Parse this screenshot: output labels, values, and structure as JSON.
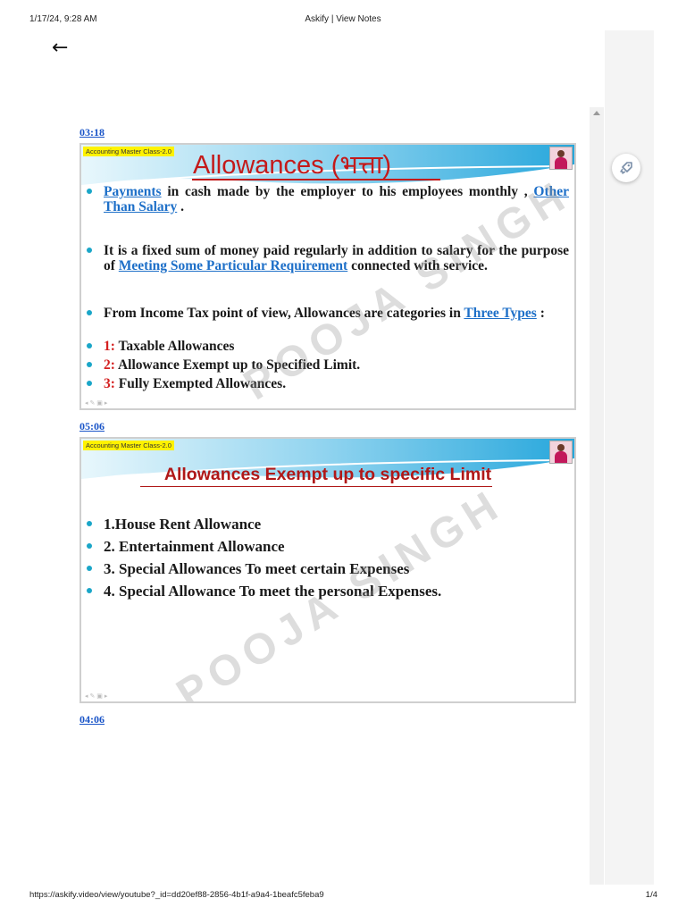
{
  "print": {
    "date": "1/17/24, 9:28 AM",
    "title": "Askify | View Notes",
    "url": "https://askify.video/view/youtube?_id=dd20ef88-2856-4b1f-a9a4-1beafc5feba9",
    "page": "1/4"
  },
  "nav": {
    "back_icon": "arrow-left-icon",
    "back_glyph": "←"
  },
  "side_button": {
    "icon": "rocket-icon"
  },
  "colors": {
    "timestamp_link": "#1a55c8",
    "slide_title_red": "#c41a1a",
    "link_blue": "#1d6fc8",
    "bullet_cyan": "#1aa6c8",
    "tagline_yellow": "#fff200"
  },
  "notes": [
    {
      "timestamp": "03:18",
      "slide": {
        "tagline": "Accounting Master Class-2.0",
        "title_en": "Allowances (",
        "title_hi": "भत्ता",
        "title_close": ")",
        "watermark": "POOJA SINGH",
        "bullets": [
          {
            "parts": [
              {
                "t": "Payments",
                "s": "link"
              },
              {
                "t": " in cash made by the employer to his employees monthly ",
                "s": ""
              },
              {
                "t": ", ",
                "s": ""
              },
              {
                "t": "Other Than Salary",
                "s": "link"
              },
              {
                "t": " .",
                "s": ""
              }
            ]
          },
          {
            "parts": [
              {
                "t": "It is a fixed sum of money paid regularly in addition to salary for the purpose of ",
                "s": ""
              },
              {
                "t": "Meeting Some Particular Requirement",
                "s": "link"
              },
              {
                "t": " connected with service.",
                "s": ""
              }
            ]
          },
          {
            "parts": [
              {
                "t": "From Income Tax point of view, Allowances are categories in ",
                "s": ""
              },
              {
                "t": "Three Types",
                "s": "link"
              },
              {
                "t": " :",
                "s": ""
              }
            ]
          },
          {
            "parts": [
              {
                "t": "1:",
                "s": "num"
              },
              {
                "t": " Taxable Allowances",
                "s": ""
              }
            ]
          },
          {
            "parts": [
              {
                "t": "2:",
                "s": "num"
              },
              {
                "t": " Allowance Exempt up to Specified Limit.",
                "s": ""
              }
            ]
          },
          {
            "parts": [
              {
                "t": "3:",
                "s": "num"
              },
              {
                "t": " Fully Exempted Allowances.",
                "s": ""
              }
            ]
          }
        ]
      }
    },
    {
      "timestamp": "05:06",
      "slide": {
        "tagline": "Accounting Master Class-2.0",
        "title": "Allowances Exempt up to specific Limit",
        "watermark": "POOJA SINGH",
        "bullets": [
          "1.House Rent Allowance",
          "2. Entertainment Allowance",
          "3. Special Allowances To meet certain Expenses",
          "4. Special Allowance To meet the personal Expenses."
        ]
      }
    },
    {
      "timestamp": "04:06"
    }
  ]
}
